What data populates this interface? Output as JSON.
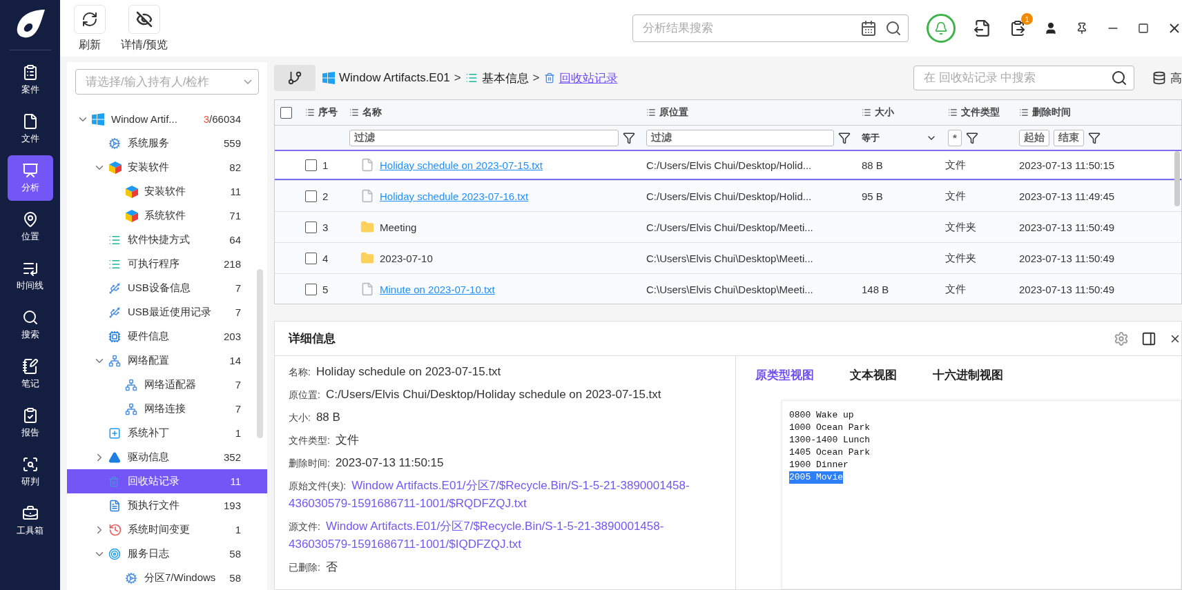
{
  "nav": [
    {
      "label": "案件",
      "selected": false
    },
    {
      "label": "文件",
      "selected": false
    },
    {
      "label": "分析",
      "selected": true
    },
    {
      "label": "位置",
      "selected": false
    },
    {
      "label": "时间线",
      "selected": false
    },
    {
      "label": "搜索",
      "selected": false
    },
    {
      "label": "笔记",
      "selected": false
    },
    {
      "label": "报告",
      "selected": false
    },
    {
      "label": "研判",
      "selected": false
    },
    {
      "label": "工具箱",
      "selected": false
    }
  ],
  "toolbar": {
    "buttons": [
      {
        "label": "刷新"
      },
      {
        "label": "详情/预览"
      }
    ],
    "search": {
      "placeholder": "分析结果搜索"
    },
    "badge": "1"
  },
  "tree": {
    "owner_select": {
      "placeholder": "请选择/输入持有人/检柞"
    },
    "items": [
      {
        "label": "Window Artif...",
        "kind": "windows",
        "flagged": "3",
        "count": "/66034",
        "expanded": true,
        "selected": false,
        "children": [
          {
            "label": "系统服务",
            "kind": "gear",
            "count": "559",
            "selected": false
          },
          {
            "label": "安装软件",
            "kind": "cube",
            "count": "82",
            "expanded": true,
            "selected": false,
            "children": [
              {
                "label": "安装软件",
                "kind": "cube",
                "count": "11",
                "selected": false
              },
              {
                "label": "系统软件",
                "kind": "cube",
                "count": "71",
                "selected": false
              }
            ]
          },
          {
            "label": "软件快捷方式",
            "kind": "list",
            "count": "64",
            "selected": false
          },
          {
            "label": "可执行程序",
            "kind": "list",
            "count": "218",
            "selected": false
          },
          {
            "label": "USB设备信息",
            "kind": "usb",
            "count": "7",
            "selected": false
          },
          {
            "label": "USB最近使用记录",
            "kind": "usb",
            "count": "7",
            "selected": false
          },
          {
            "label": "硬件信息",
            "kind": "chip",
            "count": "203",
            "selected": false
          },
          {
            "label": "网络配置",
            "kind": "card",
            "count": "14",
            "expanded": true,
            "selected": false,
            "children": [
              {
                "label": "网络适配器",
                "kind": "card",
                "count": "7",
                "selected": false
              },
              {
                "label": "网络连接",
                "kind": "card",
                "count": "7",
                "selected": false
              }
            ]
          },
          {
            "label": "系统补丁",
            "kind": "patch",
            "count": "1",
            "selected": false
          },
          {
            "label": "驱动信息",
            "kind": "drive",
            "count": "352",
            "expanded": false,
            "selected": false
          },
          {
            "label": "回收站记录",
            "kind": "bin",
            "count": "11",
            "selected": true
          },
          {
            "label": "预执行文件",
            "kind": "doc",
            "count": "193",
            "selected": false
          },
          {
            "label": "系统时间变更",
            "kind": "clock",
            "count": "1",
            "expanded": false,
            "selected": false
          },
          {
            "label": "服务日志",
            "kind": "target",
            "count": "58",
            "expanded": true,
            "selected": false,
            "children": [
              {
                "label": "分区7/Windows",
                "kind": "gear",
                "count": "58",
                "selected": false
              }
            ]
          }
        ]
      }
    ]
  },
  "breadcrumb": {
    "items": [
      {
        "label": "Window Artifacts.E01",
        "kind": "windows"
      },
      {
        "label": "基本信息",
        "kind": "list"
      },
      {
        "label": "回收站记录",
        "kind": "bin"
      }
    ],
    "separator": ">",
    "search": {
      "placeholder": "在 回收站记录 中搜索"
    },
    "advanced": "高"
  },
  "table": {
    "columns": [
      "序号",
      "名称",
      "原位置",
      "大小",
      "文件类型",
      "删除时间"
    ],
    "filters": {
      "name": "过滤",
      "location": "过滤",
      "size": "等于",
      "type": "*",
      "start": "起始",
      "end": "结束"
    },
    "header_checked": false,
    "rows": [
      {
        "index": "1",
        "kind": "file",
        "name": "Holiday schedule on 2023-07-15.txt",
        "location": "C:/Users/Elvis Chui/Desktop/Holid...",
        "size": "88 B",
        "type": "文件",
        "deleted": "2023-07-13 11:50:15",
        "checked": false,
        "selected": true
      },
      {
        "index": "2",
        "kind": "file",
        "name": "Holiday schedule 2023-07-16.txt",
        "location": "C:/Users/Elvis Chui/Desktop/Holid...",
        "size": "95 B",
        "type": "文件",
        "deleted": "2023-07-13 11:49:45",
        "checked": false,
        "selected": false
      },
      {
        "index": "3",
        "kind": "folder",
        "name": "Meeting",
        "location": "C:/Users/Elvis Chui/Desktop/Meeti...",
        "size": "",
        "type": "文件夹",
        "deleted": "2023-07-13 11:50:49",
        "checked": false,
        "selected": false
      },
      {
        "index": "4",
        "kind": "folder",
        "name": "2023-07-10",
        "location": "C:\\Users\\Elvis Chui\\Desktop\\Meeti...",
        "size": "",
        "type": "文件夹",
        "deleted": "2023-07-13 11:50:49",
        "checked": false,
        "selected": false
      },
      {
        "index": "5",
        "kind": "file",
        "name": "Minute on 2023-07-10.txt",
        "location": "C:\\Users\\Elvis Chui\\Desktop\\Meeti...",
        "size": "148 B",
        "type": "文件",
        "deleted": "2023-07-13 11:50:49",
        "checked": false,
        "selected": false
      }
    ]
  },
  "details": {
    "title": "详细信息",
    "fields": [
      {
        "label": "名称:",
        "value": "Holiday schedule on 2023-07-15.txt",
        "kind": "text"
      },
      {
        "label": "原位置:",
        "value": "C:/Users/Elvis Chui/Desktop/Holiday schedule on 2023-07-15.txt",
        "kind": "text"
      },
      {
        "label": "大小:",
        "value": "88 B",
        "kind": "text"
      },
      {
        "label": "文件类型:",
        "value": "文件",
        "kind": "text"
      },
      {
        "label": "删除时间:",
        "value": "2023-07-13 11:50:15",
        "kind": "text"
      },
      {
        "label": "原始文件(夹):",
        "value": "Window Artifacts.E01/分区7/$Recycle.Bin/S-1-5-21-3890001458-436030579-1591686711-1001/$RQDFZQJ.txt",
        "kind": "link"
      },
      {
        "label": "源文件:",
        "value": "Window Artifacts.E01/分区7/$Recycle.Bin/S-1-5-21-3890001458-436030579-1591686711-1001/$IQDFZQJ.txt",
        "kind": "link"
      },
      {
        "label": "已删除:",
        "value": "否",
        "kind": "text"
      }
    ],
    "tabs": [
      {
        "label": "原类型视图",
        "selected": true
      },
      {
        "label": "文本视图",
        "selected": false
      },
      {
        "label": "十六进制视图",
        "selected": false
      }
    ],
    "preview_lines": [
      {
        "text": "0800 Wake up",
        "highlighted": false
      },
      {
        "text": "1000 Ocean Park",
        "highlighted": false
      },
      {
        "text": "1300-1400 Lunch",
        "highlighted": false
      },
      {
        "text": "1405 Ocean Park",
        "highlighted": false
      },
      {
        "text": "1900 Dinner",
        "highlighted": false
      },
      {
        "text": "2005 Movie",
        "highlighted": true
      }
    ]
  }
}
